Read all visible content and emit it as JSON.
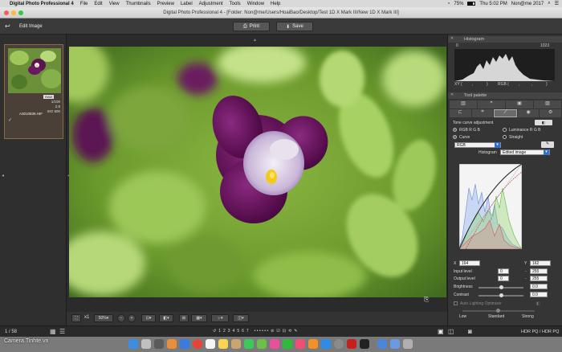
{
  "menubar": {
    "apple": "",
    "app_name": "Digital Photo Professional 4",
    "items": [
      "File",
      "Edit",
      "View",
      "Thumbnails",
      "Preview",
      "Label",
      "Adjustment",
      "Tools",
      "Window",
      "Help"
    ],
    "battery": "75%",
    "clock": "Thu 5:02 PM",
    "user": "Non@me 2017"
  },
  "window": {
    "title": "Digital Photo Professional 4 - [Folder: Non@me/Users/HoaiBao/Desktop/Test 1D X Mark III/New 1D X Mark III]"
  },
  "toolbar": {
    "edit_image_label": "Edit Image",
    "print_label": "Print",
    "save_label": "Save"
  },
  "thumbnail": {
    "badge": "RAW",
    "shutter": "1/100",
    "aperture": "2.8",
    "iso": "ISO 800",
    "filename": "A3010836.HIF",
    "selected": true
  },
  "bottombar": {
    "zoom_fit": "x1",
    "zoom_level": "50%"
  },
  "histogram_panel": {
    "title": "Histogram",
    "min": "0",
    "max": "1023",
    "xy_label": "XY (",
    "rgb_label": "RGB (",
    "xy_sep": ",",
    "xy_close": ")",
    "rgb_seps": [
      ",",
      ","
    ],
    "rgb_close": ")"
  },
  "tool_palette": {
    "title": "Tool palette",
    "section_title": "Tone curve adjustment",
    "modes": [
      "RGB R G B",
      "Luminance R G B"
    ],
    "selected_mode": "RGB R G B",
    "curve_types": [
      "Curve",
      "Straight"
    ],
    "selected_curve_type": "Curve",
    "channel": "RGB",
    "histogram_label": "Histogram",
    "histogram_source": "Edited image",
    "x_label": "X",
    "x_value": "164",
    "y_label": "Y",
    "y_value": "162",
    "input_level_label": "Input level",
    "input_level_min": "0",
    "input_level_max": "255",
    "output_level_label": "Output level",
    "output_level_min": "0",
    "output_level_max": "255",
    "brightness_label": "Brightness",
    "brightness_value": "0.0",
    "contrast_label": "Contrast",
    "contrast_value": "0.0",
    "auto_lighting_label": "Auto Lighting Optimizer",
    "auto_lighting_levels": [
      "Low",
      "Standard",
      "Strong"
    ],
    "auto_lighting_selected": "Standard"
  },
  "statusbar": {
    "page": "1 / 58",
    "color_space": "HDR PQ / HDR PQ"
  },
  "watermark": "Camera.Tinhte.vn",
  "colors": {
    "menubar_bg": "#d9d9d9",
    "panel_bg": "#353535",
    "accent_selection": "#2f6fce",
    "thumb_border": "#8a6b44"
  }
}
